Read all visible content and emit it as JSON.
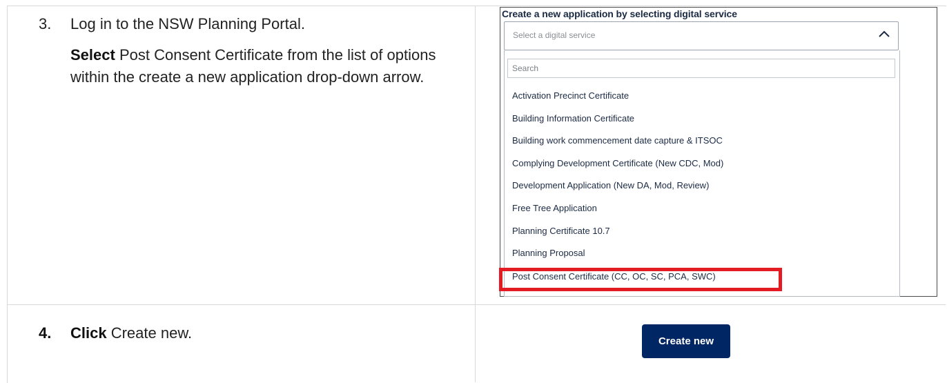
{
  "step3": {
    "number": "3.",
    "heading": "Log in to the NSW Planning Portal.",
    "action_word": "Select",
    "body": "Post Consent Certificate from the list of options within the create a new application drop-down arrow."
  },
  "step4": {
    "number": "4.",
    "action_word": "Click",
    "body": "Create new."
  },
  "portal": {
    "title": "Create a new application by selecting digital service",
    "select_placeholder": "Select a digital service",
    "search_placeholder": "Search",
    "options": [
      "Activation Precinct Certificate",
      "Building Information Certificate",
      "Building work commencement date capture & ITSOC",
      "Complying Development Certificate (New CDC, Mod)",
      "Development Application (New DA, Mod, Review)",
      "Free Tree Application",
      "Planning Certificate 10.7",
      "Planning Proposal",
      "Post Consent Certificate (CC, OC, SC, PCA, SWC)"
    ],
    "highlighted_option": "Post Consent Certificate (CC, OC, SC, PCA, SWC)",
    "highlight_color": "#e31b23",
    "icons": {
      "dropdown": "chevron-up-icon"
    }
  },
  "create_button": {
    "label": "Create new",
    "color": "#002664"
  }
}
